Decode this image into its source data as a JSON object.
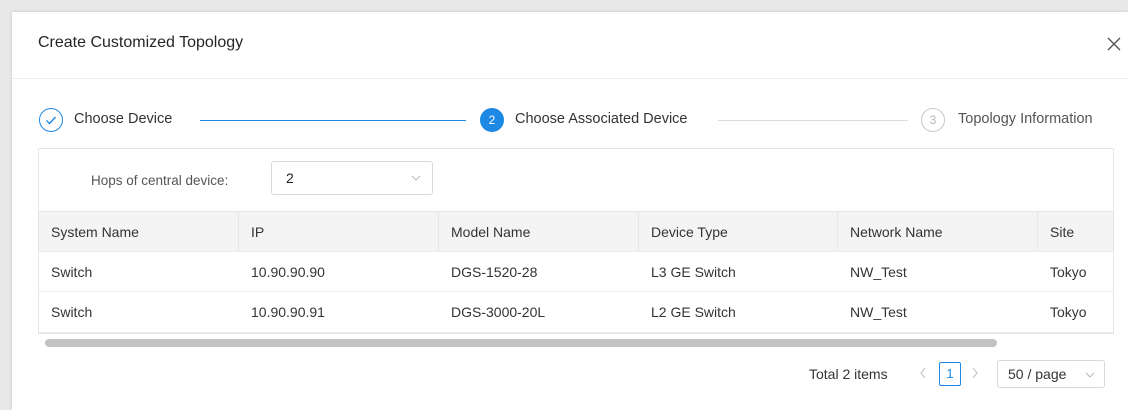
{
  "dialog": {
    "title": "Create Customized Topology",
    "close_icon": "close-icon"
  },
  "steps": [
    {
      "index": "",
      "label": "Choose Device",
      "status": "finished"
    },
    {
      "index": "2",
      "label": "Choose Associated Device",
      "status": "active"
    },
    {
      "index": "3",
      "label": "Topology Information",
      "status": "waiting"
    }
  ],
  "filter": {
    "label": "Hops of central device:",
    "value": "2"
  },
  "table": {
    "columns": [
      "System Name",
      "IP",
      "Model Name",
      "Device Type",
      "Network Name",
      "Site"
    ],
    "rows": [
      [
        "Switch",
        "10.90.90.90",
        "DGS-1520-28",
        "L3 GE Switch",
        "NW_Test",
        "Tokyo"
      ],
      [
        "Switch",
        "10.90.90.91",
        "DGS-3000-20L",
        "L2 GE Switch",
        "NW_Test",
        "Tokyo"
      ]
    ]
  },
  "pagination": {
    "total": "Total 2 items",
    "current_page": "1",
    "page_size": "50 / page"
  },
  "colors": {
    "accent": "#1e88e5",
    "header_bg": "#f4f4f4"
  }
}
